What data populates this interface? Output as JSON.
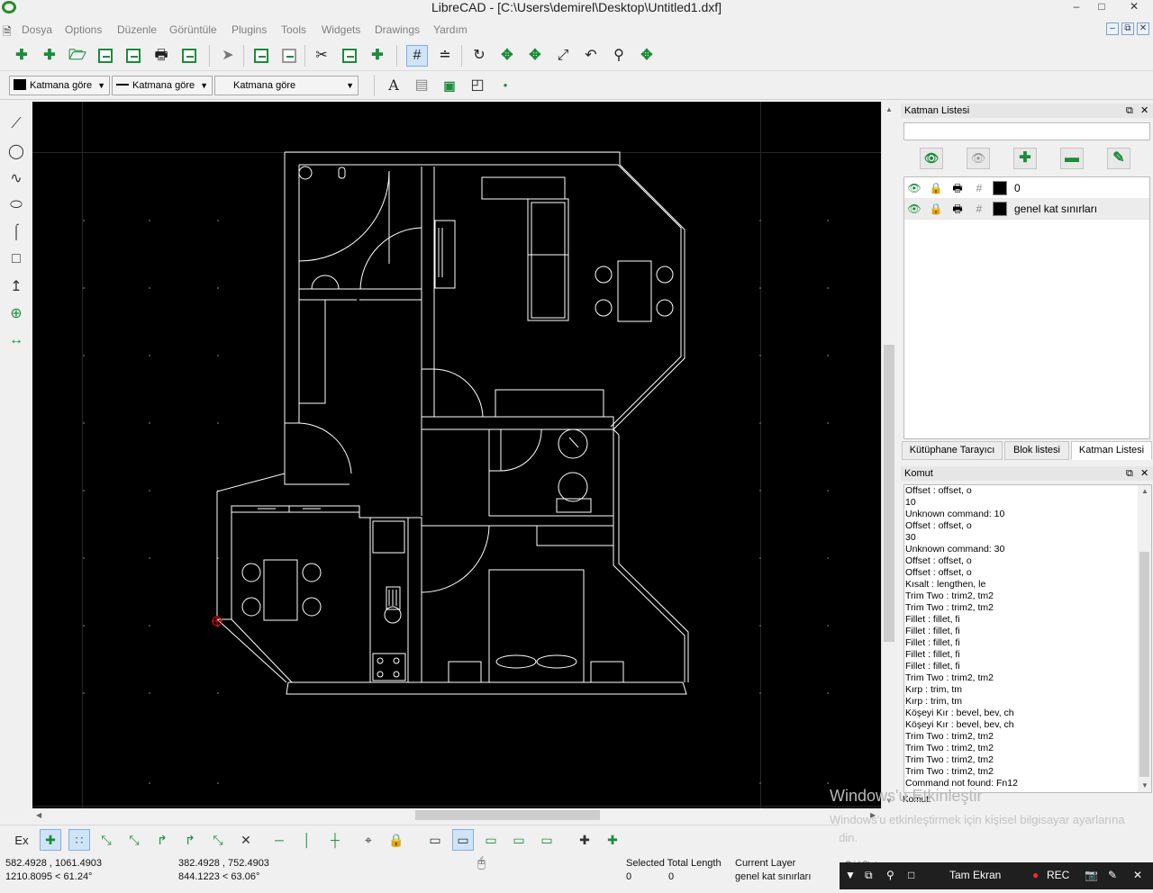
{
  "window": {
    "title": "LibreCAD - [C:\\Users\\demirel\\Desktop\\Untitled1.dxf]",
    "min": "–",
    "max": "□",
    "close": "✕"
  },
  "menu": [
    "Dosya",
    "Options",
    "Düzenle",
    "Görüntüle",
    "Plugins",
    "Tools",
    "Widgets",
    "Drawings",
    "Yardım"
  ],
  "mdi": {
    "min": "–",
    "restore": "⧉",
    "close": "✕"
  },
  "pen": {
    "color_label": "Katmana göre",
    "width_label": "Katmana göre",
    "type_label": "Katmana göre"
  },
  "layer_panel": {
    "title": "Katman Listesi",
    "filter_value": "",
    "layers": [
      {
        "name": "0",
        "visible": true,
        "locked": false,
        "print": true
      },
      {
        "name": "genel kat sınırları",
        "visible": true,
        "locked": false,
        "print": true
      }
    ]
  },
  "tabs": [
    "Kütüphane Tarayıcı",
    "Blok listesi",
    "Katman Listesi"
  ],
  "active_tab": "Katman Listesi",
  "command_panel": {
    "title": "Komut",
    "lines": [
      "Offset : offset, o",
      "10",
      "Unknown command: 10",
      "Offset : offset, o",
      "30",
      "Unknown command: 30",
      "Offset : offset, o",
      "Offset : offset, o",
      "Kısalt : lengthen, le",
      "Trim Two : trim2, tm2",
      "Trim Two : trim2, tm2",
      "Fillet : fillet, fi",
      "Fillet : fillet, fi",
      "Fillet : fillet, fi",
      "Fillet : fillet, fi",
      "Fillet : fillet, fi",
      "Trim Two : trim2, tm2",
      "Kırp : trim, tm",
      "Kırp : trim, tm",
      "Köşeyi Kır : bevel, bev, ch",
      "Köşeyi Kır : bevel, bev, ch",
      "Trim Two : trim2, tm2",
      "Trim Two : trim2, tm2",
      "Trim Two : trim2, tm2",
      "Trim Two : trim2, tm2",
      "Command not found: Fn12"
    ],
    "input_label": "Komut:"
  },
  "watermark": {
    "line1": "Windows'u Etkinleştir",
    "line2": "Windows'u etkinleştirmek için kişisel bilgisayar ayarlarına gidin."
  },
  "status": {
    "abs_coord": "582.4928 , 1061.4903",
    "abs_polar": "1210.8095 < 61.24°",
    "rel_coord": "382.4928 , 752.4903",
    "rel_polar": "844.1223 < 63.06°",
    "selected_label": "Selected Total Length",
    "selected_count": "0",
    "selected_length": "0",
    "current_layer_label": "Current Layer",
    "current_layer": "genel kat sınırları",
    "grid_status": "Grid Status"
  },
  "snap": {
    "exclusive_label": "Ex"
  },
  "taskbar": {
    "fullscreen": "Tam Ekran",
    "rec": "REC"
  },
  "colors": {
    "canvas": "#000000",
    "drawing": "#ffffff",
    "accent": "#1b8c3a",
    "grid": "#3a3a3a"
  }
}
